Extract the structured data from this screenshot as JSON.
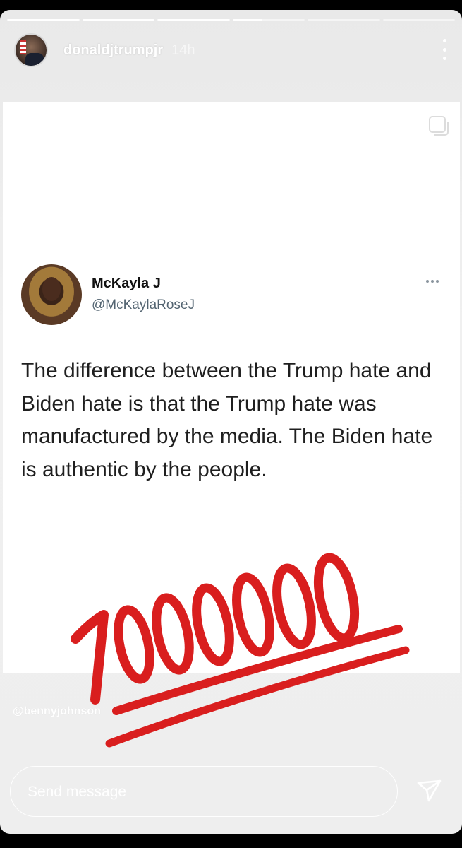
{
  "story": {
    "progress": {
      "segments": 6,
      "current": 4
    },
    "username": "donaldjtrumpjr",
    "time": "14h",
    "reply_placeholder": "Send message",
    "watermark": "@bennyjohnson",
    "icons": [
      "more-vertical-icon",
      "send-icon",
      "copy-square-icon"
    ]
  },
  "tweet": {
    "name": "McKayla J",
    "handle": "@McKaylaRoseJ",
    "text": "The difference between the Trump hate and Biden hate is that the Trump hate was manufactured by the media. The Biden hate is authentic by the people."
  },
  "sticker": {
    "label": "1000000",
    "color": "#d91e1e"
  }
}
